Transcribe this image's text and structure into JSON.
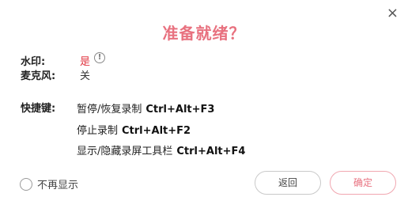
{
  "dialog": {
    "close_glyph": "×",
    "title": "准备就绪？"
  },
  "watermark": {
    "label": "水印:",
    "value": "是",
    "info_glyph": "!"
  },
  "microphone": {
    "label": "麦克风:",
    "value": "关"
  },
  "shortcuts": {
    "label": "快捷键:",
    "items": [
      {
        "action": "暂停/恢复录制",
        "keys": "Ctrl+Alt+F3"
      },
      {
        "action": "停止录制",
        "keys": "Ctrl+Alt+F2"
      },
      {
        "action": "显示/隐藏录屏工具栏",
        "keys": "Ctrl+Alt+F4"
      }
    ]
  },
  "footer": {
    "dont_show_label": "不再显示",
    "back_label": "返回",
    "confirm_label": "确定"
  },
  "colors": {
    "accent": "#e8717f",
    "watermark_value": "#e0343f"
  }
}
